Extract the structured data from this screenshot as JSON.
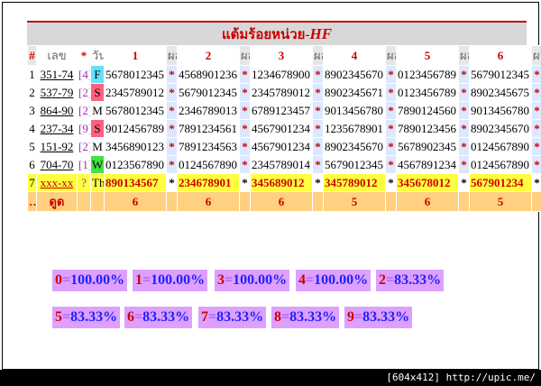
{
  "title_prefix": "แต้มร้อยหน่วย-",
  "title_suffix": "HF",
  "header": {
    "hash": "#",
    "draw": "เลข",
    "star": "*",
    "day": "วัน",
    "cols": [
      "1",
      "2",
      "3",
      "4",
      "5",
      "6"
    ],
    "small": "ผล",
    "last": "ผลิ"
  },
  "rows": [
    {
      "idx": "1",
      "draw": "351-74",
      "br": "[4]",
      "day": "F",
      "cells": [
        "5678012345",
        "4568901236",
        "1234678900",
        "8902345670",
        "0123456789",
        "5679012345"
      ]
    },
    {
      "idx": "2",
      "draw": "537-79",
      "br": "[2]",
      "day": "S",
      "cells": [
        "2345789012",
        "5679012345",
        "2345789012",
        "8902345671",
        "0123456789",
        "8902345675"
      ]
    },
    {
      "idx": "3",
      "draw": "864-90",
      "br": "[2]",
      "day": "M",
      "cells": [
        "5678012345",
        "2346789013",
        "6789123457",
        "9013456780",
        "7890124560",
        "9013456780"
      ]
    },
    {
      "idx": "4",
      "draw": "237-34",
      "br": "[9]",
      "day": "S",
      "cells": [
        "9012456789",
        "7891234561",
        "4567901234",
        "1235678901",
        "7890123456",
        "8902345670"
      ]
    },
    {
      "idx": "5",
      "draw": "151-92",
      "br": "[2]",
      "day": "M",
      "cells": [
        "3456890123",
        "7891234563",
        "4567901234",
        "8902345670",
        "5678902345",
        "0124567890"
      ]
    },
    {
      "idx": "6",
      "draw": "704-70",
      "br": "[1]",
      "day": "W",
      "cells": [
        "0123567890",
        "0124567890",
        "2345789014",
        "5679012345",
        "4567891234",
        "0124567890"
      ]
    },
    {
      "idx": "7",
      "draw": "xxx-xx",
      "br": "?",
      "day": "Th",
      "cells": [
        "890134567",
        "234678901",
        "345689012",
        "345789012",
        "345678012",
        "567901234"
      ]
    }
  ],
  "footer": {
    "label": "ดูด",
    "values": [
      "6",
      "6",
      "6",
      "5",
      "6",
      "5"
    ]
  },
  "results": [
    {
      "digit": "0",
      "pct": "100.00%"
    },
    {
      "digit": "1",
      "pct": "100.00%"
    },
    {
      "digit": "3",
      "pct": "100.00%"
    },
    {
      "digit": "4",
      "pct": "100.00%"
    },
    {
      "digit": "2",
      "pct": "83.33%"
    },
    {
      "digit": "5",
      "pct": "83.33%"
    },
    {
      "digit": "6",
      "pct": "83.33%"
    },
    {
      "digit": "7",
      "pct": "83.33%"
    },
    {
      "digit": "8",
      "pct": "83.33%"
    },
    {
      "digit": "9",
      "pct": "83.33%"
    }
  ],
  "watermark": "[604x412] http://upic.me/",
  "colors": {
    "accent_red": "#cc0000",
    "star_bg": "#dde8ff",
    "yellow_row": "#ffff40",
    "orange_row": "#ffd080",
    "result_bg": "#dda0ff"
  }
}
